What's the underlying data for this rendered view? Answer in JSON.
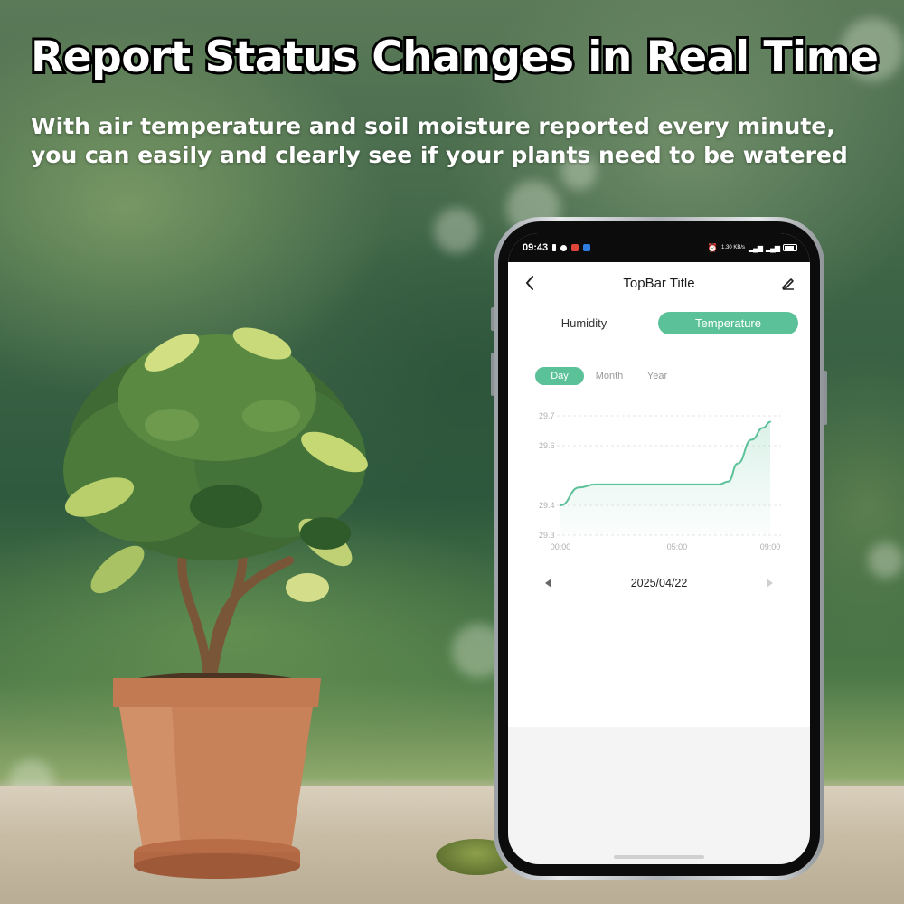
{
  "headline": "Report Status Changes in Real Time",
  "subline": [
    "With air temperature and soil moisture reported every minute,",
    "you can easily and clearly see if your plants need to be watered"
  ],
  "phone": {
    "status_bar": {
      "time": "09:43",
      "network_text": "1.30 KB/s"
    },
    "app_bar": {
      "title": "TopBar Title",
      "back_icon": "back-chevron-icon",
      "edit_icon": "pencil-icon"
    },
    "tabs": [
      {
        "label": "Humidity",
        "active": false
      },
      {
        "label": "Temperature",
        "active": true
      }
    ],
    "range_tabs": [
      {
        "label": "Day",
        "active": true
      },
      {
        "label": "Month",
        "active": false
      },
      {
        "label": "Year",
        "active": false
      }
    ],
    "date": "2025/04/22",
    "accent_color": "#5bc198"
  },
  "chart_data": {
    "type": "area",
    "title": "",
    "xlabel": "",
    "ylabel": "",
    "x_ticks": [
      "00:00",
      "05:00",
      "09:00"
    ],
    "y_ticks": [
      "29.7",
      "29.6",
      "29.4",
      "29.3"
    ],
    "ylim": [
      29.3,
      29.7
    ],
    "xlim": [
      0,
      9
    ],
    "grid": true,
    "series": [
      {
        "x": [
          0,
          0.8,
          1.5,
          2.5,
          4,
          5,
          6,
          6.8,
          7.2,
          7.6,
          8.2,
          8.7,
          9.0
        ],
        "y": [
          29.4,
          29.46,
          29.47,
          29.47,
          29.47,
          29.47,
          29.47,
          29.47,
          29.48,
          29.54,
          29.62,
          29.66,
          29.68
        ]
      }
    ],
    "color": "#5bc198"
  }
}
